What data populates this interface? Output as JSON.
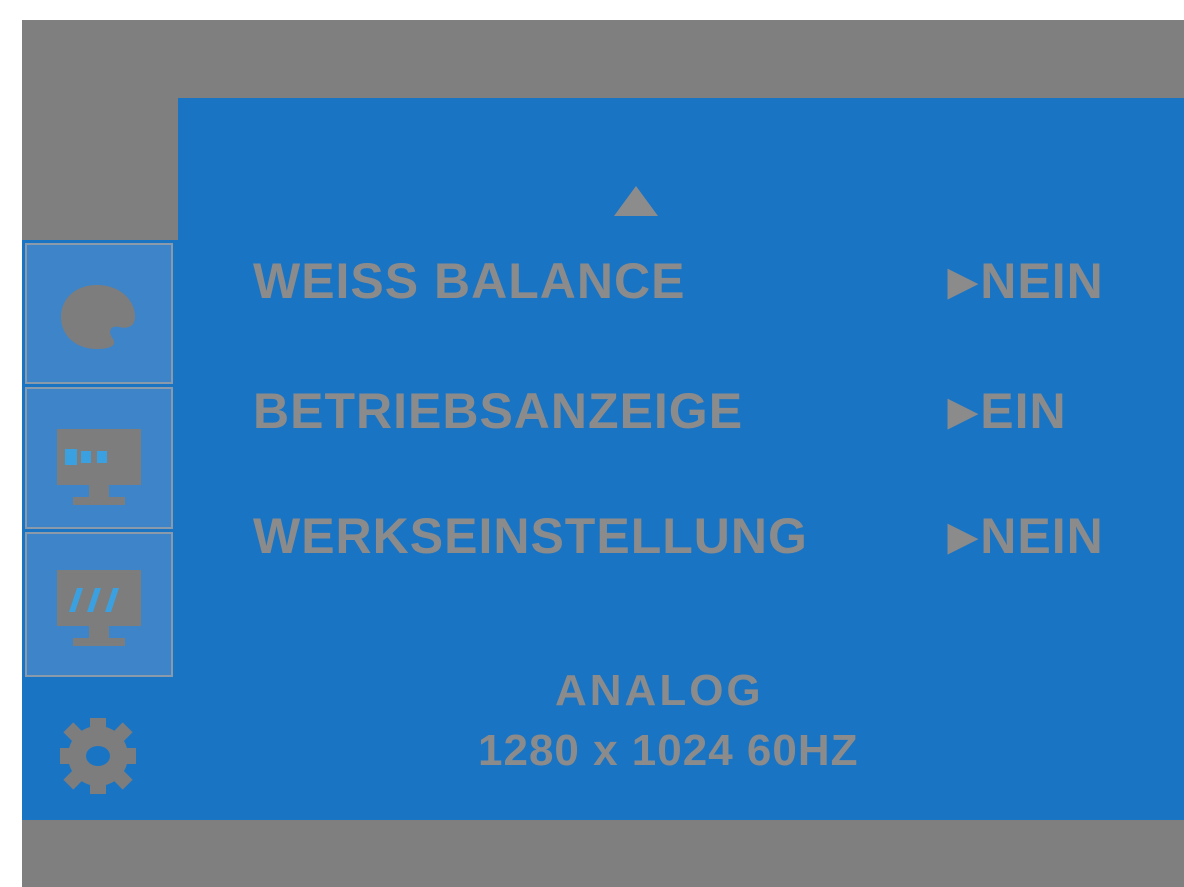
{
  "menu": {
    "items": [
      {
        "label": "WEISS BALANCE",
        "value": "NEIN"
      },
      {
        "label": "BETRIEBSANZEIGE",
        "value": "EIN"
      },
      {
        "label": "WERKSEINSTELLUNG",
        "value": "NEIN"
      }
    ],
    "value_marker": "▶",
    "scroll_up_icon": "up-triangle-icon"
  },
  "sidebar": {
    "tabs": [
      {
        "icon": "color-palette-icon"
      },
      {
        "icon": "monitor-position-icon"
      },
      {
        "icon": "monitor-tracking-icon"
      },
      {
        "icon": "gear-icon"
      }
    ]
  },
  "status": {
    "input": "ANALOG",
    "resolution": "1280 x 1024 60HZ"
  },
  "colors": {
    "panel_blue": "#1a74c4",
    "frame_gray": "#7f7f7f",
    "text_gray": "#8b8b8b"
  }
}
